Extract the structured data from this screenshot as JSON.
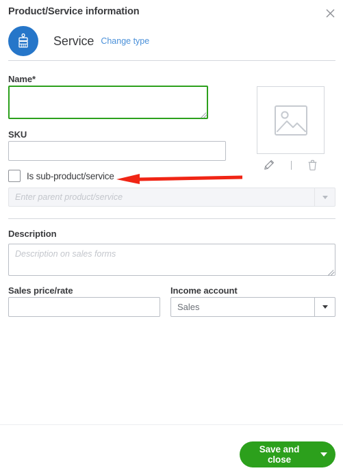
{
  "header": {
    "title": "Product/Service information",
    "close_icon": "close-icon"
  },
  "type_row": {
    "icon": "paintbrush-service-icon",
    "type_name": "Service",
    "change_type_link": "Change type"
  },
  "fields": {
    "name": {
      "label": "Name*",
      "value": "",
      "placeholder": "",
      "focused": true
    },
    "sku": {
      "label": "SKU",
      "value": "",
      "placeholder": ""
    },
    "sub_product": {
      "label": "Is sub-product/service",
      "checked": false
    },
    "parent": {
      "placeholder": "Enter parent product/service",
      "value": "",
      "disabled": true
    },
    "description": {
      "label": "Description",
      "placeholder": "Description on sales forms",
      "value": ""
    },
    "sales_price": {
      "label": "Sales price/rate",
      "value": "",
      "placeholder": ""
    },
    "income_account": {
      "label": "Income account",
      "value": "Sales"
    }
  },
  "image": {
    "placeholder_icon": "photo-placeholder-icon",
    "edit_icon": "pencil-edit-icon",
    "delete_icon": "trash-delete-icon"
  },
  "footer": {
    "save_label": "Save and close",
    "save_caret_icon": "chevron-down-icon"
  },
  "annotation": {
    "arrow_color": "#f02515",
    "arrow_direction": "left",
    "points_at": "is-sub-product-checkbox"
  },
  "colors": {
    "brand_blue": "#2676c9",
    "link_blue": "#4a90d9",
    "focus_green": "#2ca01c",
    "save_green": "#2ca01c",
    "text_dark": "#393a3d",
    "border_grey": "#babec5",
    "divider_grey": "#d4d7dc",
    "disabled_bg": "#f4f5f8"
  }
}
